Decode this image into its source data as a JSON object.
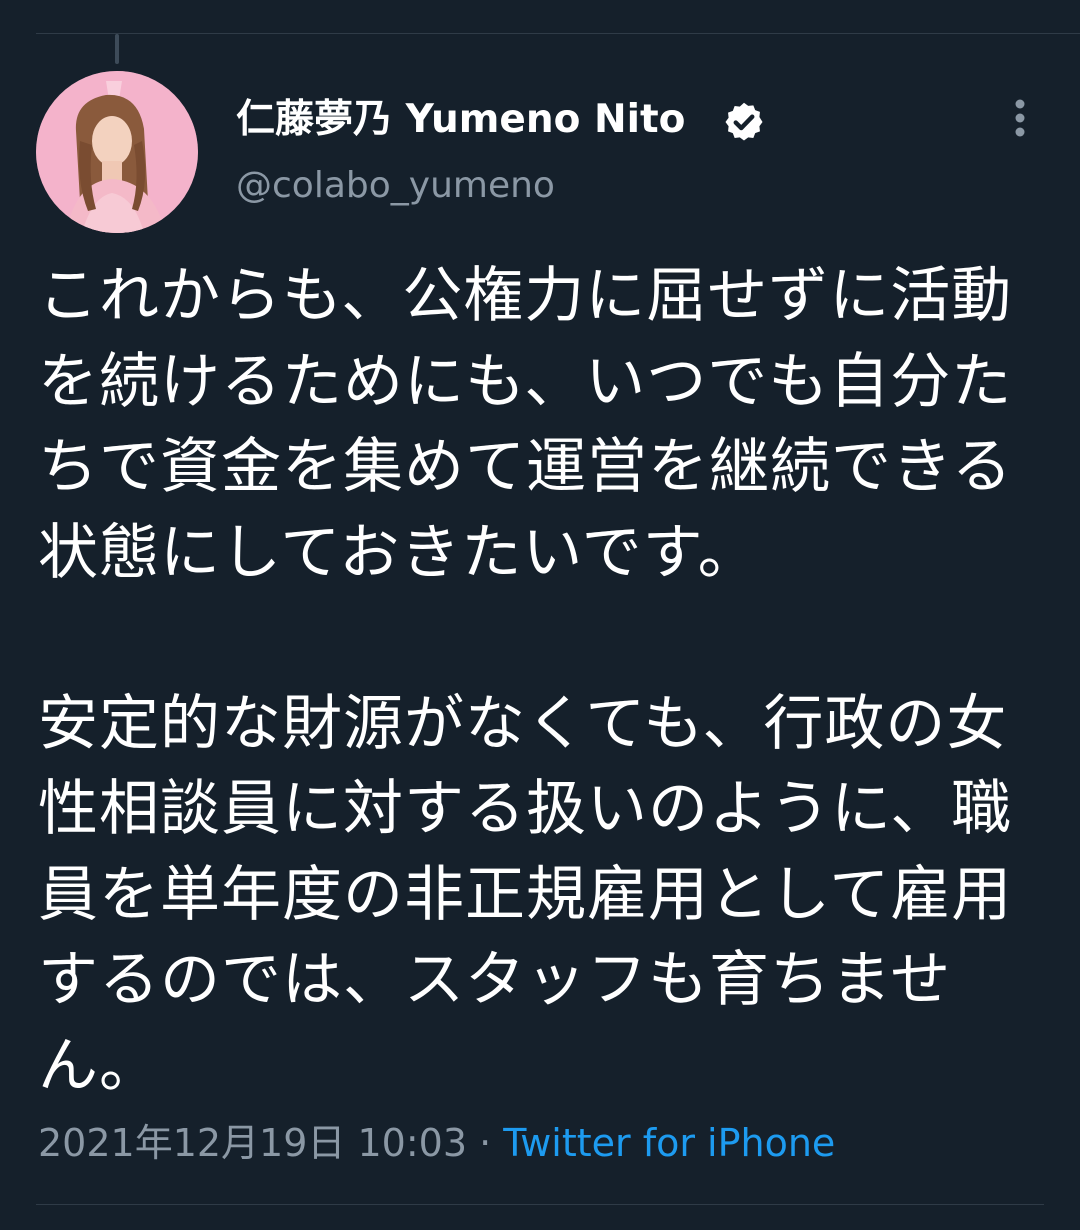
{
  "tweet": {
    "author": {
      "display_name": "仁藤夢乃 Yumeno Nito",
      "handle": "@colabo_yumeno",
      "verified": true,
      "avatar_icon": "avatar-photo"
    },
    "text": "これからも、公権力に屈せずに活動を続けるためにも、いつでも自分たちで資金を集めて運営を継続できる状態にしておきたいです。\n\n安定的な財源がなくても、行政の女性相談員に対する扱いのように、職員を単年度の非正規雇用として雇用するのでは、スタッフも育ちません。",
    "timestamp": "2021年12月19日 10:03",
    "separator": " · ",
    "source": "Twitter for iPhone",
    "more_icon": "more-vertical-icon"
  },
  "colors": {
    "background": "#15202b",
    "text_primary": "#ffffff",
    "text_secondary": "#8b98a5",
    "link": "#1d9bf0",
    "divider": "#2f3b47"
  }
}
